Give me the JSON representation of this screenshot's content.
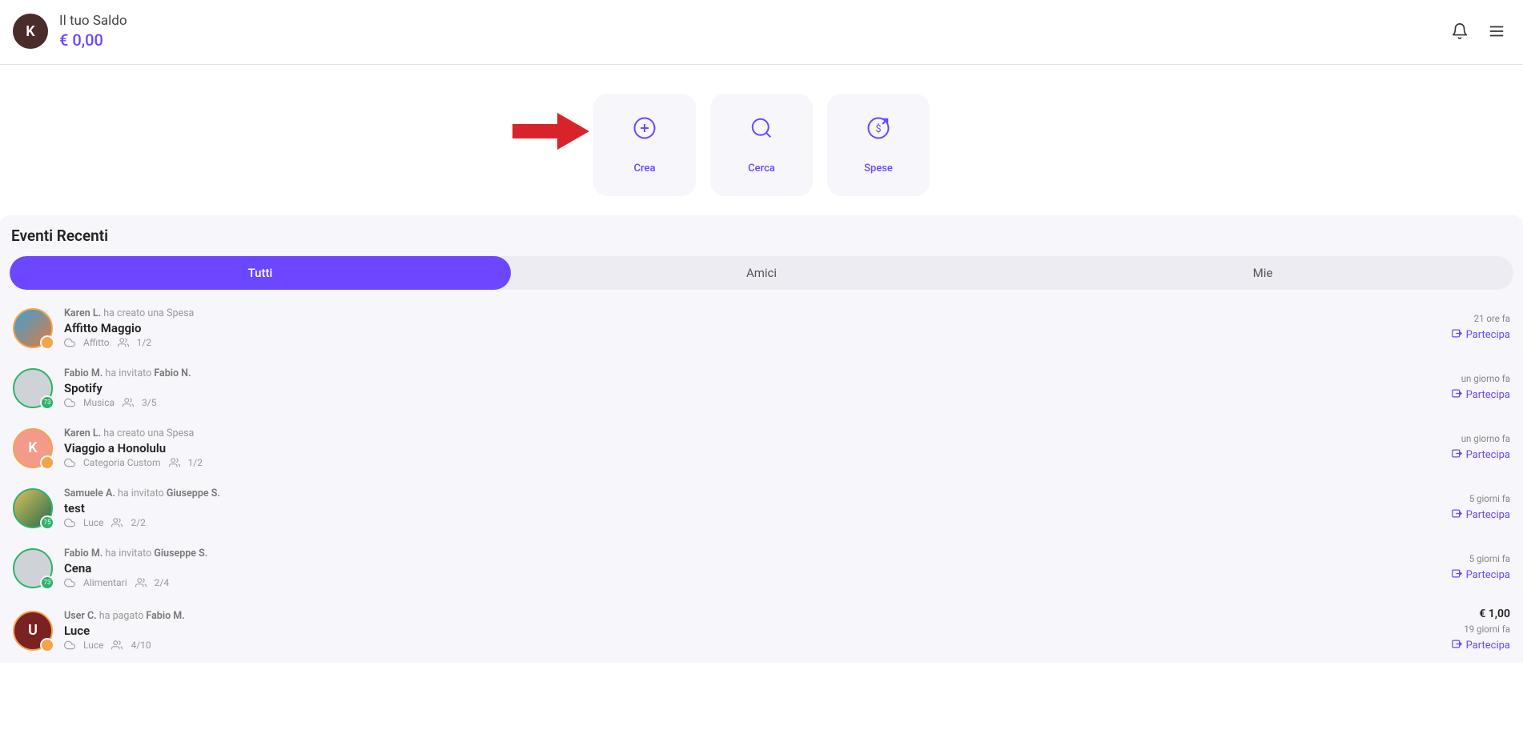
{
  "header": {
    "avatar_letter": "K",
    "balance_label": "Il tuo Saldo",
    "balance_amount": "€ 0,00"
  },
  "actions": {
    "create": "Crea",
    "search": "Cerca",
    "expenses": "Spese"
  },
  "section": {
    "title": "Eventi Recenti"
  },
  "tabs": {
    "all": "Tutti",
    "friends": "Amici",
    "mine": "Mie"
  },
  "join_label": "Partecipa",
  "events": [
    {
      "avatar_bg": "linear-gradient(135deg,#3aa1d8,#e07a3f)",
      "avatar_letter": "",
      "ring": "orange",
      "badge": "orange",
      "badge_text": "",
      "author": "Karen L.",
      "action_text": " ha creato una Spesa",
      "target": "",
      "title": "Affitto Maggio",
      "category": "Affitto",
      "people": "1/2",
      "time": "21 ore fa",
      "amount": ""
    },
    {
      "avatar_bg": "#cfd3d8",
      "avatar_letter": "",
      "ring": "green",
      "badge": "green",
      "badge_text": "73",
      "author": "Fabio M.",
      "action_text": " ha invitato ",
      "target": "Fabio N.",
      "title": "Spotify",
      "category": "Musica",
      "people": "3/5",
      "time": "un giorno fa",
      "amount": ""
    },
    {
      "avatar_bg": "#f39a8b",
      "avatar_letter": "K",
      "ring": "orange",
      "badge": "orange",
      "badge_text": "",
      "author": "Karen L.",
      "action_text": " ha creato una Spesa",
      "target": "",
      "title": "Viaggio a Honolulu",
      "category": "Categoria Custom",
      "people": "1/2",
      "time": "un giorno fa",
      "amount": ""
    },
    {
      "avatar_bg": "linear-gradient(135deg,#d8c25a,#2a6b4a)",
      "avatar_letter": "",
      "ring": "green",
      "badge": "green",
      "badge_text": "75",
      "author": "Samuele A.",
      "action_text": " ha invitato ",
      "target": "Giuseppe S.",
      "title": "test",
      "category": "Luce",
      "people": "2/2",
      "time": "5 giorni fa",
      "amount": ""
    },
    {
      "avatar_bg": "#cfd3d8",
      "avatar_letter": "",
      "ring": "green",
      "badge": "green",
      "badge_text": "73",
      "author": "Fabio M.",
      "action_text": " ha invitato ",
      "target": "Giuseppe S.",
      "title": "Cena",
      "category": "Alimentari",
      "people": "2/4",
      "time": "5 giorni fa",
      "amount": ""
    },
    {
      "avatar_bg": "#7a2222",
      "avatar_letter": "U",
      "ring": "orange",
      "badge": "orange",
      "badge_text": "",
      "author": "User C.",
      "action_text": " ha pagato ",
      "target": "Fabio M.",
      "title": "Luce",
      "category": "Luce",
      "people": "4/10",
      "time": "19 giorni fa",
      "amount": "€ 1,00"
    }
  ]
}
